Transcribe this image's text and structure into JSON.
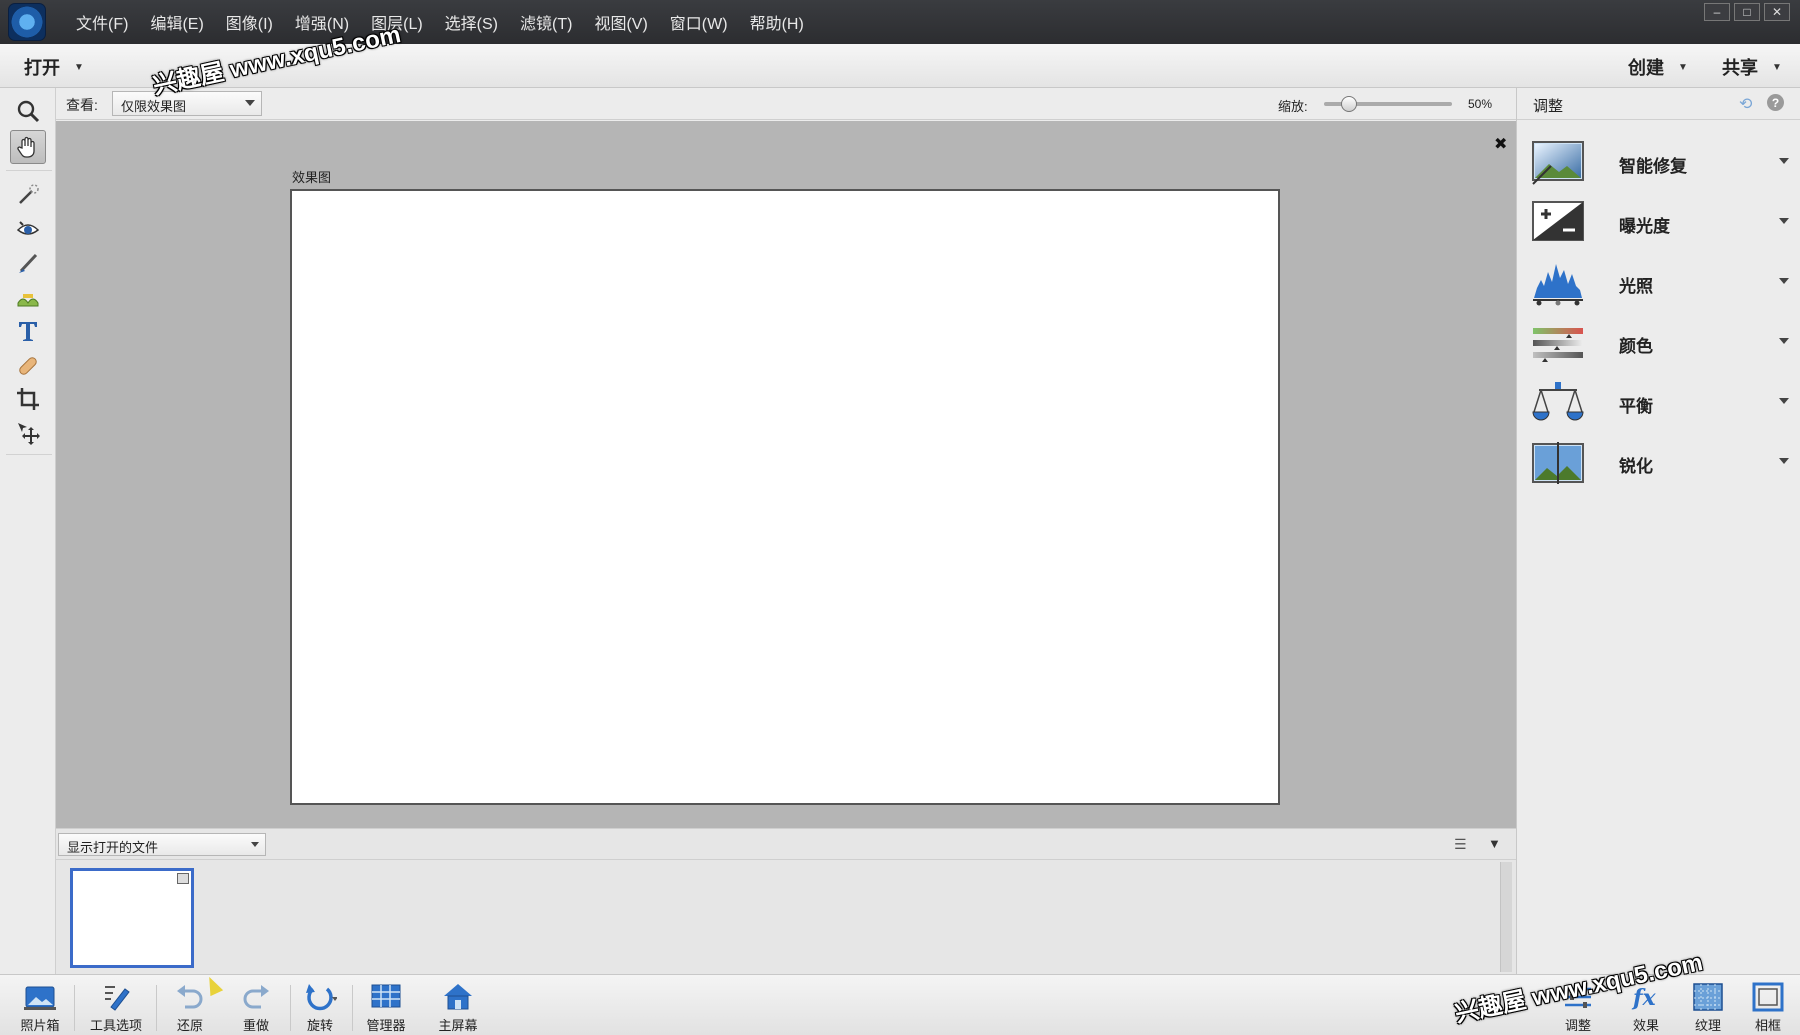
{
  "menubar": {
    "items": [
      "文件(F)",
      "编辑(E)",
      "图像(I)",
      "增强(N)",
      "图层(L)",
      "选择(S)",
      "滤镜(T)",
      "视图(V)",
      "窗口(W)",
      "帮助(H)"
    ],
    "window_controls": [
      "–",
      "□",
      "✕"
    ]
  },
  "header": {
    "open_label": "打开",
    "create_label": "创建",
    "share_label": "共享"
  },
  "options": {
    "view_label": "查看:",
    "view_value": "仅限效果图",
    "zoom_label": "缩放:",
    "zoom_value": "50%",
    "zoom_fraction": 0.15
  },
  "document": {
    "title": "效果图",
    "close_glyph": "✖"
  },
  "bin": {
    "filter_value": "显示打开的文件"
  },
  "panel": {
    "title": "调整",
    "help_glyph": "?",
    "items": [
      {
        "label": "智能修复",
        "icon": "smart-fix-icon"
      },
      {
        "label": "曝光度",
        "icon": "exposure-icon"
      },
      {
        "label": "光照",
        "icon": "lighting-icon"
      },
      {
        "label": "颜色",
        "icon": "color-icon"
      },
      {
        "label": "平衡",
        "icon": "balance-icon"
      },
      {
        "label": "锐化",
        "icon": "sharpen-icon"
      }
    ]
  },
  "taskbar": {
    "left": [
      {
        "label": "照片箱",
        "icon": "photo-bin-icon"
      },
      {
        "label": "工具选项",
        "icon": "tool-options-icon"
      },
      {
        "label": "还原",
        "icon": "undo-icon"
      },
      {
        "label": "重做",
        "icon": "redo-icon"
      },
      {
        "label": "旋转",
        "icon": "rotate-icon"
      },
      {
        "label": "管理器",
        "icon": "organizer-icon"
      },
      {
        "label": "主屏幕",
        "icon": "home-screen-icon"
      }
    ],
    "right": [
      {
        "label": "调整",
        "icon": "adjustments-icon"
      },
      {
        "label": "效果",
        "icon": "effects-icon"
      },
      {
        "label": "纹理",
        "icon": "textures-icon"
      },
      {
        "label": "相框",
        "icon": "frames-icon"
      }
    ]
  },
  "watermark": {
    "text": "兴趣屋 www.xqu5.com"
  },
  "colors": {
    "accent": "#3b6bc9",
    "canvas_bg": "#b5b5b5",
    "menubar_bg": "#2c2d30"
  }
}
